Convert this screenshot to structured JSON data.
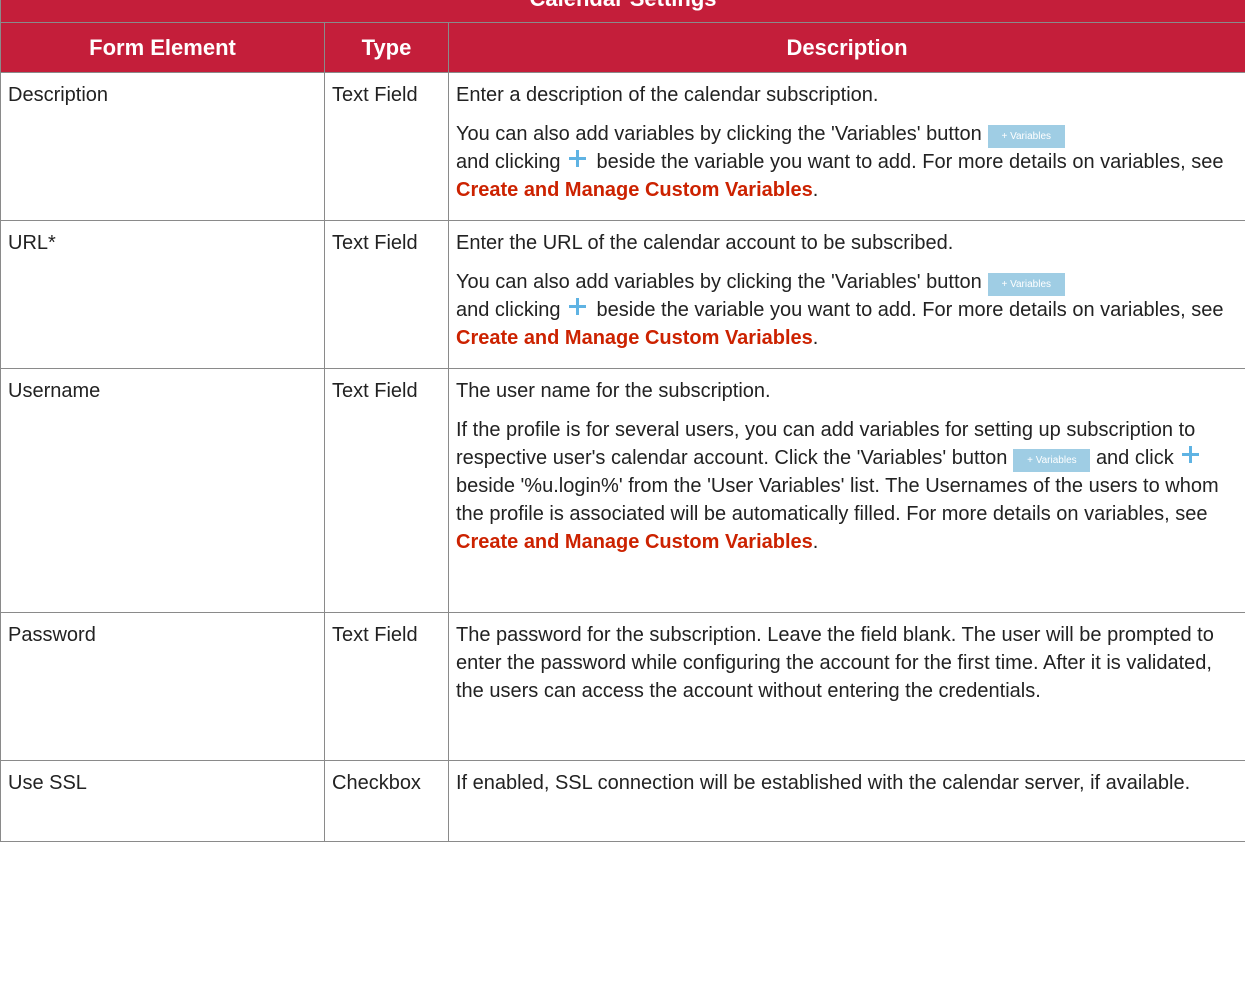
{
  "table": {
    "title": "Calendar Settings",
    "headers": [
      "Form Element",
      "Type",
      "Description"
    ],
    "link_text": "Create and Manage Custom Variables",
    "variables_button_label": "+ Variables",
    "rows": [
      {
        "element": "Description",
        "type": "Text Field",
        "p1": "Enter a description of the calendar subscription.",
        "p2_start": "You can also add variables by clicking the 'Variables' button",
        "p2_mid": "and clicking",
        "p2_after_plus": "beside the variable you want to add. For more details on variables, see",
        "p2_end": "."
      },
      {
        "element": "URL*",
        "type": "Text Field",
        "p1": "Enter the URL of the calendar account to be subscribed.",
        "p2_start": "You can also add variables by clicking the 'Variables' button",
        "p2_mid": "and clicking",
        "p2_after_plus": "beside the variable you want to add. For more details on variables, see",
        "p2_end": "."
      },
      {
        "element": "Username",
        "type": "Text Field",
        "p1": "The user name for the subscription.",
        "p2_start": "If the profile is for several users, you can add variables for setting up subscription to respective user's calendar account. Click the 'Variables' button",
        "p2_mid": "and click",
        "p2_after_plus": "beside '%u.login%' from the 'User Variables' list. The Usernames of the users to whom the profile is associated will be automatically filled. For more details on variables, see",
        "p2_end": "."
      },
      {
        "element": "Password",
        "type": "Text Field",
        "p1": "The password for the subscription. Leave the field blank. The user will be prompted to enter the password while configuring the account for the first time. After it is validated, the users can access the account without entering the credentials."
      },
      {
        "element": "Use SSL",
        "type": "Checkbox",
        "p1": "If enabled, SSL connection will be established with the calendar server, if available."
      }
    ]
  }
}
